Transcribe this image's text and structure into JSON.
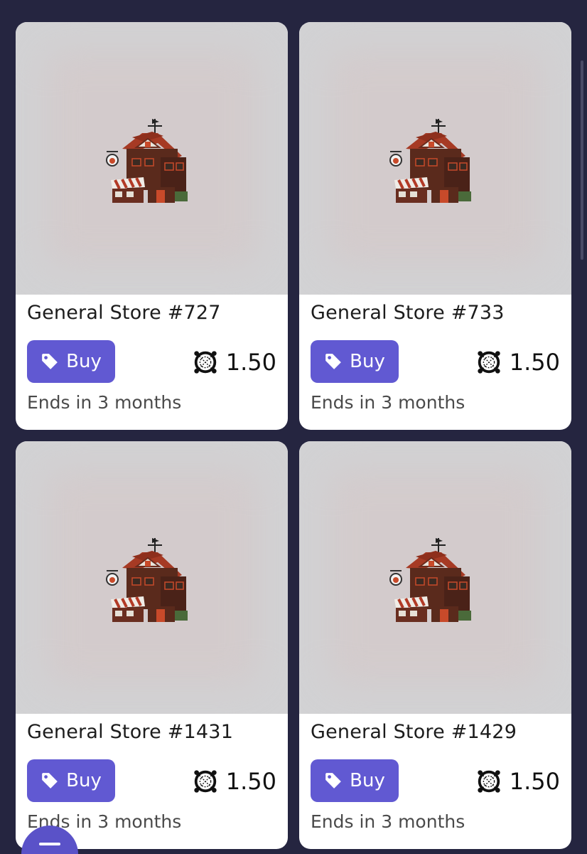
{
  "listings": [
    {
      "title": "General Store #727",
      "buy_label": "Buy",
      "price": "1.50",
      "ends": "Ends in 3 months"
    },
    {
      "title": "General Store #733",
      "buy_label": "Buy",
      "price": "1.50",
      "ends": "Ends in 3 months"
    },
    {
      "title": "General Store #1431",
      "buy_label": "Buy",
      "price": "1.50",
      "ends": "Ends in 3 months"
    },
    {
      "title": "General Store #1429",
      "buy_label": "Buy",
      "price": "1.50",
      "ends": "Ends in 3 months"
    }
  ],
  "icons": {
    "buy": "tag-icon",
    "currency": "currency-token-icon",
    "image": "general-store-house-icon",
    "fab": "menu-icon"
  },
  "colors": {
    "background": "#252540",
    "card": "#ffffff",
    "thumbnail": "#d2d2d4",
    "accent": "#6159d2",
    "text": "#1c1c1c",
    "muted_text": "#4a4a4a"
  }
}
